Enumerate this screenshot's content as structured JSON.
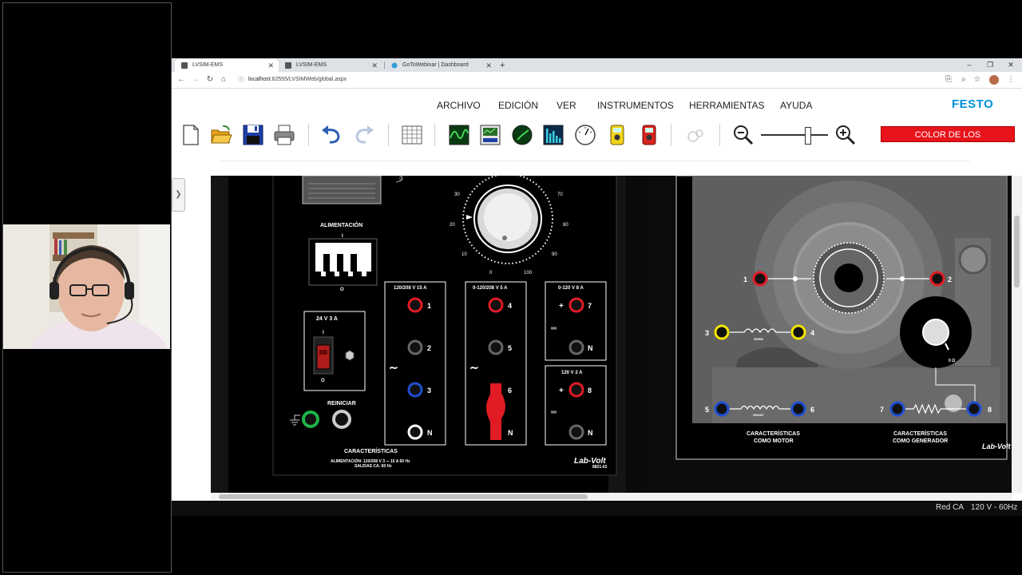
{
  "browser": {
    "tabs": [
      {
        "title": "LVSIM-EMS",
        "active": true
      },
      {
        "title": "LVSIM-EMS",
        "active": false
      },
      {
        "title": "GoToWebinar | Dashboard",
        "active": false
      }
    ],
    "new_tab": "+",
    "url_host": "localhost",
    "url_path": ":62555/LVSIMWeb/global.aspx",
    "window_controls": [
      "–",
      "❐",
      "✕"
    ]
  },
  "menu": {
    "items": [
      "ARCHIVO",
      "EDICIÓN",
      "VER",
      "INSTRUMENTOS",
      "HERRAMIENTAS",
      "AYUDA"
    ],
    "brand": "FESTO"
  },
  "toolbar": {
    "icons": [
      "new-file-icon",
      "open-folder-icon",
      "save-icon",
      "print-icon",
      "undo-icon",
      "redo-icon",
      "grid-icon",
      "oscilloscope-icon",
      "phasor-analyzer-icon",
      "metering-icon",
      "harmonic-analyzer-icon",
      "multimeter-icon",
      "meter-icon",
      "zoom-out-icon",
      "zoom-in-icon"
    ],
    "color_button": "COLOR DE LOS CONDUCTORES",
    "zoom_level": 0.7
  },
  "power_supply": {
    "alimentacion": "ALIMENTACIÓN",
    "switch_on": "I",
    "switch_off": "O",
    "small_rating": "24 V  3 A",
    "reiniciar": "REINICIAR",
    "knob_ticks": [
      "0",
      "10",
      "20",
      "30",
      "70",
      "80",
      "90",
      "100"
    ],
    "fixed_output": {
      "rating": "120/208 V   15 A",
      "terminals": [
        "1",
        "2",
        "3",
        "N"
      ]
    },
    "variable_output": {
      "rating": "0-120/208 V   5 A",
      "terminals": [
        "4",
        "5",
        "6",
        "N"
      ]
    },
    "dc_variable": {
      "rating": "0-120 V   8 A",
      "terminals": [
        "7",
        "N"
      ],
      "plus": "+"
    },
    "dc_fixed": {
      "rating": "120 V   2 A",
      "terminals": [
        "8",
        "N"
      ],
      "plus": "+"
    },
    "ac_symbol": "∼",
    "dc_symbol": "═",
    "caracteristicas": "CARACTERÍSTICAS",
    "spec_line1": "ALIMENTACIÓN: 120/208 V   3 ∼  15 A   60 Hz",
    "spec_line2": "SALIDAS CA: 60 Hz",
    "brand": "Lab-Volt",
    "model": "8821-02"
  },
  "dc_machine": {
    "terminals": [
      "1",
      "2",
      "3",
      "4",
      "5",
      "6",
      "7",
      "8"
    ],
    "serie": "SERIE",
    "shunt": "SHUNT",
    "ohm": "0 Ω",
    "motor_label_1": "CARACTERÍSTICAS",
    "motor_label_2": "COMO MOTOR",
    "gen_label_1": "CARACTERÍSTICAS",
    "gen_label_2": "COMO GENERADOR",
    "brand": "Lab-Volt"
  },
  "status": {
    "network": "Red CA",
    "voltage": "120 V - 60Hz"
  },
  "colors": {
    "accent_red": "#e8131b",
    "festo_blue": "#0091dc",
    "terminal_red": "#e01b24",
    "terminal_blue": "#1f4fd1",
    "terminal_yellow": "#f2e400",
    "terminal_green": "#1db34a"
  }
}
